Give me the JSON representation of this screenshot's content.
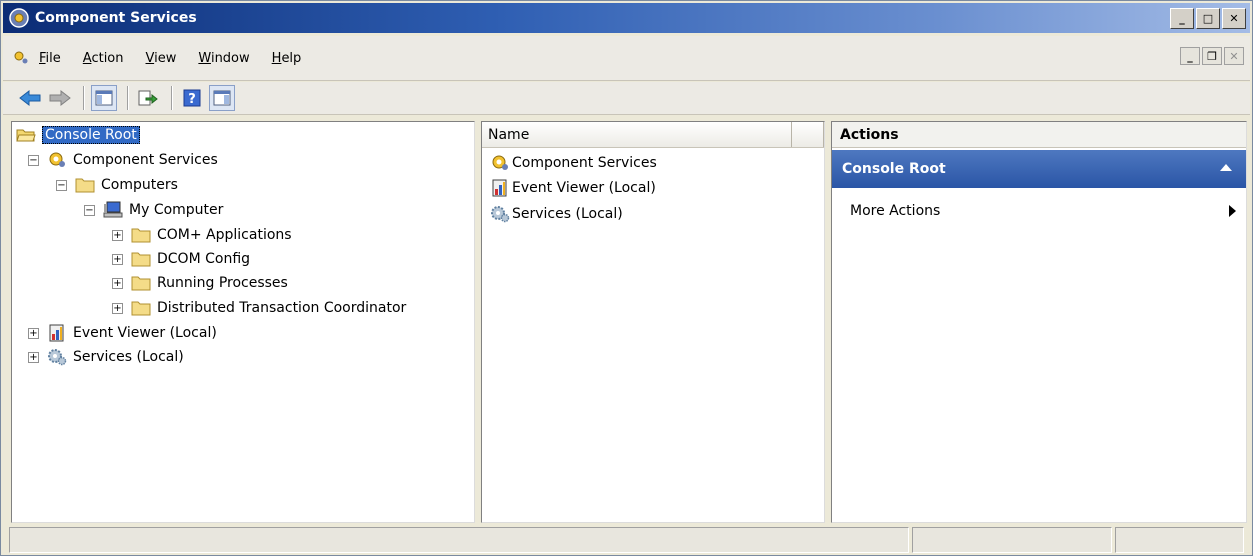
{
  "window": {
    "title": "Component Services"
  },
  "menubar": {
    "items": [
      {
        "label": "File",
        "underline": "F"
      },
      {
        "label": "Action",
        "underline": "A"
      },
      {
        "label": "View",
        "underline": "V"
      },
      {
        "label": "Window",
        "underline": "W"
      },
      {
        "label": "Help",
        "underline": "H"
      }
    ]
  },
  "toolbar": {
    "buttons": [
      "back-icon",
      "forward-icon",
      "show-hide-console-tree-icon",
      "export-list-icon",
      "help-icon",
      "show-hide-action-pane-icon"
    ]
  },
  "tree": {
    "root": "Console Root",
    "component_services": "Component Services",
    "computers": "Computers",
    "my_computer": "My Computer",
    "com_apps": "COM+ Applications",
    "dcom_config": "DCOM Config",
    "running_processes": "Running Processes",
    "dtc": "Distributed Transaction Coordinator",
    "event_viewer": "Event Viewer (Local)",
    "services": "Services (Local)"
  },
  "list": {
    "column_name": "Name",
    "items": [
      "Component Services",
      "Event Viewer (Local)",
      "Services (Local)"
    ]
  },
  "actions": {
    "header": "Actions",
    "section": "Console Root",
    "more_actions": "More Actions"
  },
  "colors": {
    "title_bar": "#0b2c75",
    "selection": "#316ac5",
    "actions_section": "#2a55a6"
  }
}
